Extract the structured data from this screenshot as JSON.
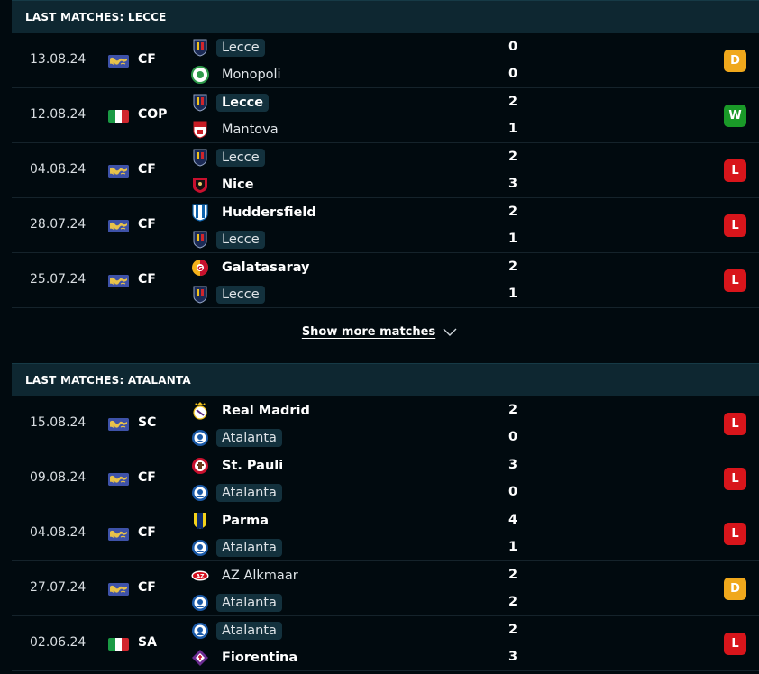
{
  "lecce": {
    "header": "LAST MATCHES: LECCE",
    "matches": [
      {
        "date": "13.08.24",
        "flag": "world",
        "league": "CF",
        "home": "Lecce",
        "home_crest": "lecce",
        "home_hl": true,
        "home_bold": false,
        "away": "Monopoli",
        "away_crest": "monopoli",
        "away_hl": false,
        "away_bold": false,
        "home_score": "0",
        "away_score": "0",
        "result": "D"
      },
      {
        "date": "12.08.24",
        "flag": "italy",
        "league": "COP",
        "home": "Lecce",
        "home_crest": "lecce",
        "home_hl": true,
        "home_bold": true,
        "away": "Mantova",
        "away_crest": "mantova",
        "away_hl": false,
        "away_bold": false,
        "home_score": "2",
        "away_score": "1",
        "result": "W"
      },
      {
        "date": "04.08.24",
        "flag": "world",
        "league": "CF",
        "home": "Lecce",
        "home_crest": "lecce",
        "home_hl": true,
        "home_bold": false,
        "away": "Nice",
        "away_crest": "nice",
        "away_hl": false,
        "away_bold": true,
        "home_score": "2",
        "away_score": "3",
        "result": "L"
      },
      {
        "date": "28.07.24",
        "flag": "world",
        "league": "CF",
        "home": "Huddersfield",
        "home_crest": "huddersfield",
        "home_hl": false,
        "home_bold": true,
        "away": "Lecce",
        "away_crest": "lecce",
        "away_hl": true,
        "away_bold": false,
        "home_score": "2",
        "away_score": "1",
        "result": "L"
      },
      {
        "date": "25.07.24",
        "flag": "world",
        "league": "CF",
        "home": "Galatasaray",
        "home_crest": "galatasaray",
        "home_hl": false,
        "home_bold": true,
        "away": "Lecce",
        "away_crest": "lecce",
        "away_hl": true,
        "away_bold": false,
        "home_score": "2",
        "away_score": "1",
        "result": "L"
      }
    ]
  },
  "show_more": {
    "label": "Show more matches",
    "icon": "chevron-down-icon"
  },
  "atalanta": {
    "header": "LAST MATCHES: ATALANTA",
    "matches": [
      {
        "date": "15.08.24",
        "flag": "world",
        "league": "SC",
        "home": "Real Madrid",
        "home_crest": "realmadrid",
        "home_hl": false,
        "home_bold": true,
        "away": "Atalanta",
        "away_crest": "atalanta",
        "away_hl": true,
        "away_bold": false,
        "home_score": "2",
        "away_score": "0",
        "result": "L"
      },
      {
        "date": "09.08.24",
        "flag": "world",
        "league": "CF",
        "home": "St. Pauli",
        "home_crest": "stpauli",
        "home_hl": false,
        "home_bold": true,
        "away": "Atalanta",
        "away_crest": "atalanta",
        "away_hl": true,
        "away_bold": false,
        "home_score": "3",
        "away_score": "0",
        "result": "L"
      },
      {
        "date": "04.08.24",
        "flag": "world",
        "league": "CF",
        "home": "Parma",
        "home_crest": "parma",
        "home_hl": false,
        "home_bold": true,
        "away": "Atalanta",
        "away_crest": "atalanta",
        "away_hl": true,
        "away_bold": false,
        "home_score": "4",
        "away_score": "1",
        "result": "L"
      },
      {
        "date": "27.07.24",
        "flag": "world",
        "league": "CF",
        "home": "AZ Alkmaar",
        "home_crest": "az",
        "home_hl": false,
        "home_bold": false,
        "away": "Atalanta",
        "away_crest": "atalanta",
        "away_hl": true,
        "away_bold": false,
        "home_score": "2",
        "away_score": "2",
        "result": "D"
      },
      {
        "date": "02.06.24",
        "flag": "italy",
        "league": "SA",
        "home": "Atalanta",
        "home_crest": "atalanta",
        "home_hl": true,
        "home_bold": false,
        "away": "Fiorentina",
        "away_crest": "fiorentina",
        "away_hl": false,
        "away_bold": true,
        "home_score": "2",
        "away_score": "3",
        "result": "L"
      }
    ]
  },
  "colors": {
    "draw": "#f0a81c",
    "win": "#1a9a28",
    "loss": "#d8151b",
    "header_bg": "#0e2731",
    "page_bg": "#010a0f"
  }
}
